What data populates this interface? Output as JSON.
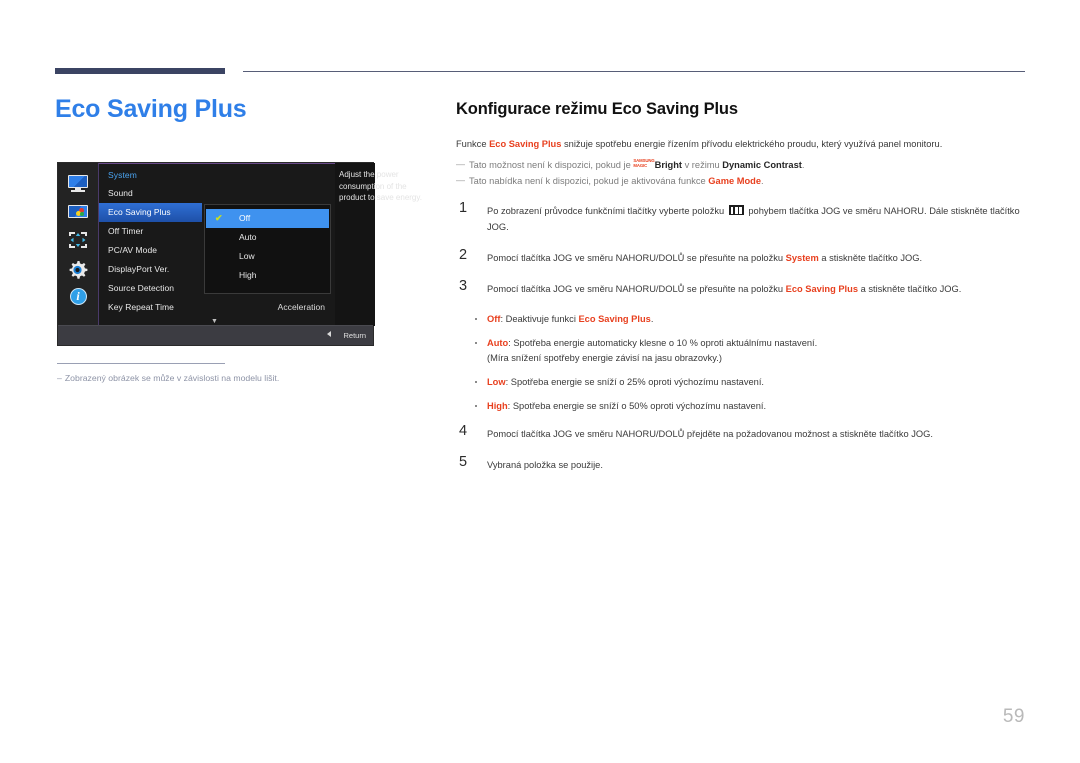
{
  "chapter": {
    "title": "Eco Saving Plus"
  },
  "osd": {
    "sidebar_icons": [
      "monitor-icon",
      "picture-icon",
      "arrows-icon",
      "gear-icon",
      "info-icon"
    ],
    "header": "System",
    "menu_items": [
      {
        "label": "Sound",
        "value": ""
      },
      {
        "label": "Eco Saving Plus",
        "value": ""
      },
      {
        "label": "Off Timer",
        "value": ""
      },
      {
        "label": "PC/AV Mode",
        "value": ""
      },
      {
        "label": "DisplayPort Ver.",
        "value": ""
      },
      {
        "label": "Source Detection",
        "value": ""
      },
      {
        "label": "Key Repeat Time",
        "value": "Acceleration"
      }
    ],
    "selected_menu_index": 1,
    "scroll_indicator": "▼",
    "submenu_items": [
      "Off",
      "Auto",
      "Low",
      "High"
    ],
    "submenu_selected_index": 0,
    "check_glyph": "✔",
    "help_text": "Adjust the power consumption of the product to save energy.",
    "return_label": "Return"
  },
  "left_note": {
    "dash": "–",
    "text": "Zobrazený obrázek se může v závislosti na modelu lišit."
  },
  "section": {
    "title": "Konfigurace režimu Eco Saving Plus",
    "lead_parts": {
      "a": "Funkce ",
      "b": "Eco Saving Plus",
      "c": " snižuje spotřebu energie řízením přívodu elektrického proudu, který využívá panel monitoru."
    },
    "notes": [
      {
        "em": "—",
        "a": "Tato možnost není k dispozici, pokud je ",
        "magic_line1": "SAMSUNG",
        "magic_line2": "MAGIC",
        "bright": "Bright",
        "b": " v režimu ",
        "c": "Dynamic Contrast",
        "d": "."
      },
      {
        "em": "—",
        "a": "Tato nabídka není k dispozici, pokud je aktivována funkce ",
        "c": "Game Mode",
        "d": "."
      }
    ]
  },
  "steps": [
    {
      "num": "1",
      "a": "Po zobrazení průvodce funkčními tlačítky vyberte položku ",
      "icon": "jog-menu-icon",
      "b": " pohybem tlačítka JOG ve směru NAHORU. Dále stiskněte tlačítko JOG."
    },
    {
      "num": "2",
      "a": "Pomocí tlačítka JOG ve směru NAHORU/DOLŮ se přesuňte na položku ",
      "hl": "System",
      "b": " a stiskněte tlačítko JOG."
    },
    {
      "num": "3",
      "a": "Pomocí tlačítka JOG ve směru NAHORU/DOLŮ se přesuňte na položku ",
      "hl": "Eco Saving Plus",
      "b": " a stiskněte tlačítko JOG."
    }
  ],
  "bullets": [
    {
      "hl": "Off",
      "a": ": Deaktivuje funkci ",
      "hl2": "Eco Saving Plus",
      "b": ".",
      "sub": ""
    },
    {
      "hl": "Auto",
      "a": ": Spotřeba energie automaticky klesne o 10 % oproti aktuálnímu nastavení.",
      "hl2": "",
      "b": "",
      "sub": "(Míra snížení spotřeby energie závisí na jasu obrazovky.)"
    },
    {
      "hl": "Low",
      "a": ": Spotřeba energie se sníží o 25% oproti výchozímu nastavení.",
      "hl2": "",
      "b": "",
      "sub": ""
    },
    {
      "hl": "High",
      "a": ": Spotřeba energie se sníží o 50% oproti výchozímu nastavení.",
      "hl2": "",
      "b": "",
      "sub": ""
    }
  ],
  "steps_tail": [
    {
      "num": "4",
      "a": "Pomocí tlačítka JOG ve směru NAHORU/DOLŮ přejděte na požadovanou možnost a stiskněte tlačítko JOG.",
      "hl": "",
      "b": ""
    },
    {
      "num": "5",
      "a": "Vybraná položka se použije.",
      "hl": "",
      "b": ""
    }
  ],
  "page_number": "59",
  "colors": {
    "chapter_blue": "#2f7fe8",
    "accent_red": "#e8401f",
    "rule_navy": "#3b4463",
    "osd_select_blue": "#3f92ef",
    "page_number_gray": "#b9b9b9"
  }
}
